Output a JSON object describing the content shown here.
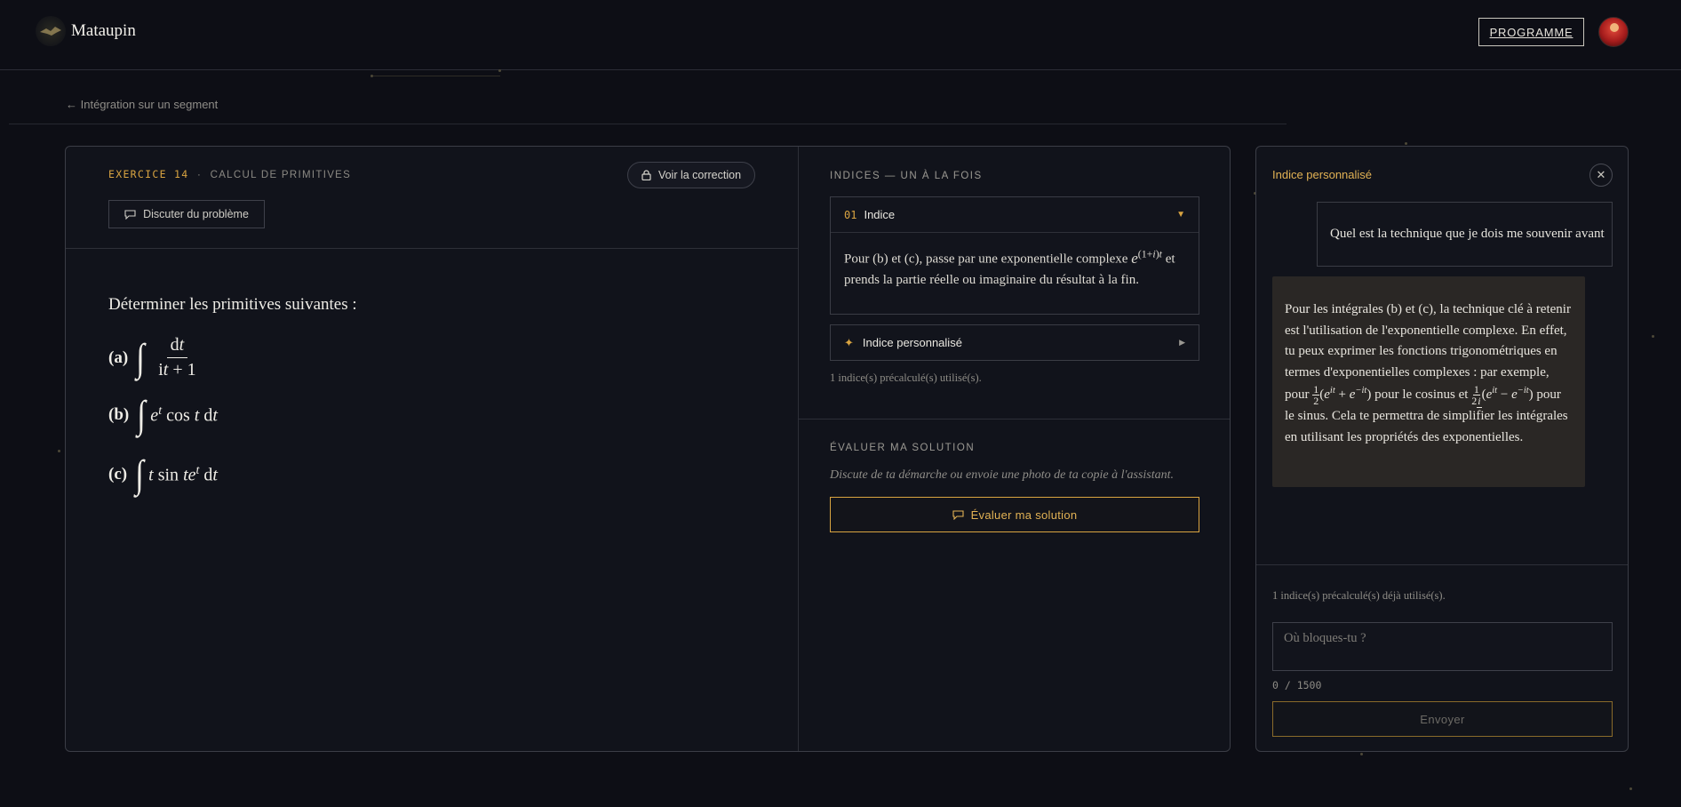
{
  "header": {
    "brand": "Mataupin",
    "programme_label": "PROGRAMME"
  },
  "breadcrumb": {
    "label": "← Intégration sur un segment"
  },
  "exercise": {
    "number_label": "EXERCICE 14",
    "separator": "·",
    "category": "CALCUL DE PRIMITIVES",
    "correction_label": "Voir la correction",
    "discuss_label": "Discuter du problème",
    "problem_title": "Déterminer les primitives suivantes :",
    "items": [
      {
        "label": "(a)",
        "expr": "∫ dt / (it + 1)"
      },
      {
        "label": "(b)",
        "expr": "∫ e^t cos t dt"
      },
      {
        "label": "(c)",
        "expr": "∫ t sin te^t dt"
      }
    ]
  },
  "hints": {
    "section_label": "INDICES — UN À LA FOIS",
    "hint1_number": "01",
    "hint1_title": "Indice",
    "hint1_text_before": "Pour (b) et (c), passe par une exponentielle complexe",
    "hint1_text_after": "et prends la partie réelle ou imaginaire du résultat à la fin.",
    "perso_label": "Indice personnalisé",
    "used_note": "1 indice(s) précalculé(s) utilisé(s)."
  },
  "evaluate": {
    "section_label": "ÉVALUER MA SOLUTION",
    "description": "Discute de ta démarche ou envoie une photo de ta copie à l'assistant.",
    "button_label": "Évaluer ma solution"
  },
  "panel": {
    "title": "Indice personnalisé",
    "user_message": "Quel est la technique que je dois me souvenir avant",
    "bot_part1": "Pour les intégrales (b) et (c), la technique clé à retenir est l'utilisation de l'exponentielle complexe. En effet, tu peux exprimer les fonctions trigonométriques en termes d'exponentielles complexes : par exemple, pour",
    "bot_part2": "pour le cosinus et",
    "bot_part3": "pour le sinus. Cela te permettra de simplifier les intégrales en utilisant les propriétés des exponentielles.",
    "used_note": "1 indice(s) précalculé(s) déjà utilisé(s).",
    "input_placeholder": "Où bloques-tu ?",
    "counter": "0 / 1500",
    "send_label": "Envoyer"
  },
  "colors": {
    "background": "#0d0e15",
    "accent": "#d9a441",
    "panel": "#11131b",
    "bot_bubble": "#2a2725"
  }
}
